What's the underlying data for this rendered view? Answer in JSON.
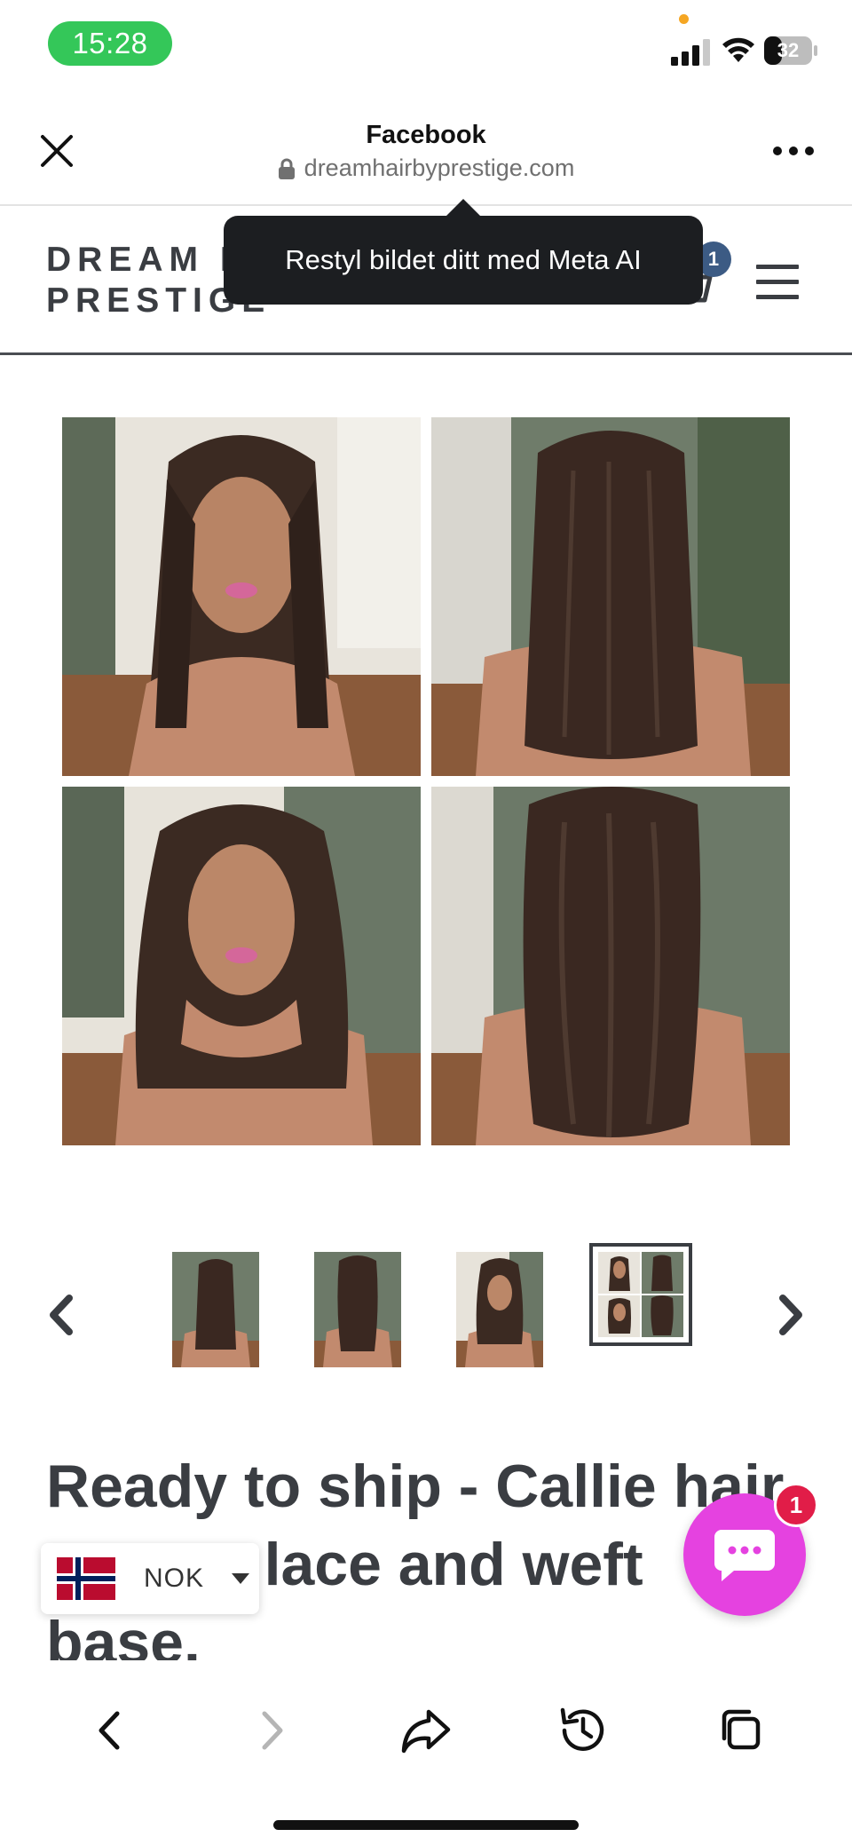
{
  "status_bar": {
    "time": "15:28",
    "battery": "32"
  },
  "browser": {
    "title": "Facebook",
    "url": "dreamhairbyprestige.com"
  },
  "site": {
    "logo": "DREAM H\nPRESTIGE",
    "cart_count": "1"
  },
  "tooltip": {
    "text": "Restyl bildet ditt med Meta AI"
  },
  "product": {
    "title": "Ready to ship - Callie hair topper, lace and weft base."
  },
  "currency": {
    "code": "NOK"
  },
  "chat": {
    "badge_count": "1"
  },
  "colors": {
    "time_pill": "#34c759",
    "chat_button": "#e542e0",
    "chat_badge": "#e11d48",
    "cart_badge": "#3c5b84",
    "tooltip_bg": "#1c1e21"
  },
  "icons": [
    "close-icon",
    "lock-icon",
    "more-icon",
    "cart-icon",
    "menu-icon",
    "chevron-left-icon",
    "chevron-right-icon",
    "flag-norway-icon",
    "caret-down-icon",
    "chat-icon",
    "back-icon",
    "forward-icon",
    "share-icon",
    "history-icon",
    "tabs-icon"
  ]
}
